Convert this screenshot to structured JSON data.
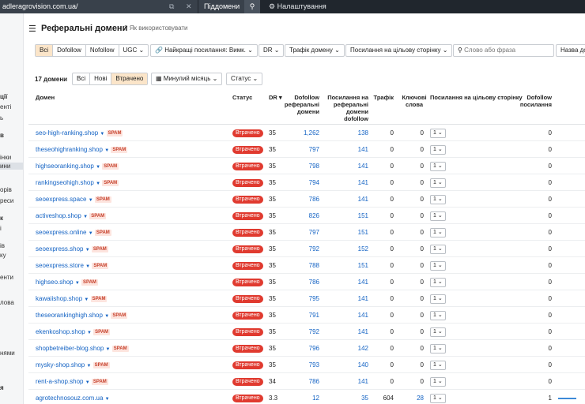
{
  "topbar": {
    "url": "adleragrovision.com.ua/",
    "subdomain_label": "Піддомени ⌄",
    "settings_label": "Налаштування"
  },
  "sidebar": {
    "fragments": [
      "ції",
      "енті",
      "ь",
      "в",
      "інки",
      "ини",
      "орів",
      "реси",
      "к",
      "і",
      "ів",
      "ку",
      "енти",
      "лова",
      "нями",
      "я"
    ]
  },
  "header": {
    "title": "Реферальні домени",
    "howto": "Як використовувати"
  },
  "filters": {
    "link_type": [
      "Всі",
      "Dofollow",
      "Nofollow",
      "UGC ⌄"
    ],
    "best_links": "Найкращі посилання: Вимк. ⌄",
    "dr": "DR ⌄",
    "domain_traffic": "Трафік домену ⌄",
    "target_links": "Посилання на цільову сторінку ⌄",
    "search_placeholder": "Слово або фраза",
    "domain_name": "Назва до"
  },
  "summary": {
    "count": "17 домени",
    "status_tabs": [
      "Всі",
      "Нові",
      "Втрачено"
    ],
    "period": "Минулий місяць ⌄",
    "status_filter": "Статус ⌄"
  },
  "columns": {
    "domain": "Домен",
    "status": "Статус",
    "dr": "DR ▾",
    "dofollow_ref": [
      "Dofollow",
      "реферальні",
      "домени"
    ],
    "links_ref": [
      "Посилання на",
      "реферальні",
      "домени",
      "dofollow"
    ],
    "traffic": "Трафік",
    "keywords": [
      "Ключові",
      "слова"
    ],
    "target_links": "Посилання на цільову сторінку",
    "dofollow_links": [
      "Dofollow",
      "посилання"
    ]
  },
  "rows": [
    {
      "domain": "seo-high-ranking.shop",
      "spam": "SPAM",
      "status": "Втрачено",
      "dr": "35",
      "dofollow": "1,262",
      "links": "138",
      "traffic": "0",
      "keywords": "0",
      "target": "1 ⌄",
      "dofollow_links": "0"
    },
    {
      "domain": "theseohighranking.shop",
      "spam": "SPAM",
      "status": "Втрачено",
      "dr": "35",
      "dofollow": "797",
      "links": "141",
      "traffic": "0",
      "keywords": "0",
      "target": "1 ⌄",
      "dofollow_links": "0"
    },
    {
      "domain": "highseoranking.shop",
      "spam": "SPAM",
      "status": "Втрачено",
      "dr": "35",
      "dofollow": "798",
      "links": "141",
      "traffic": "0",
      "keywords": "0",
      "target": "1 ⌄",
      "dofollow_links": "0"
    },
    {
      "domain": "rankingseohigh.shop",
      "spam": "SPAM",
      "status": "Втрачено",
      "dr": "35",
      "dofollow": "794",
      "links": "141",
      "traffic": "0",
      "keywords": "0",
      "target": "1 ⌄",
      "dofollow_links": "0"
    },
    {
      "domain": "seoexpress.space",
      "spam": "SPAM",
      "status": "Втрачено",
      "dr": "35",
      "dofollow": "786",
      "links": "141",
      "traffic": "0",
      "keywords": "0",
      "target": "1 ⌄",
      "dofollow_links": "0"
    },
    {
      "domain": "activeshop.shop",
      "spam": "SPAM",
      "status": "Втрачено",
      "dr": "35",
      "dofollow": "826",
      "links": "151",
      "traffic": "0",
      "keywords": "0",
      "target": "1 ⌄",
      "dofollow_links": "0"
    },
    {
      "domain": "seoexpress.online",
      "spam": "SPAM",
      "status": "Втрачено",
      "dr": "35",
      "dofollow": "797",
      "links": "151",
      "traffic": "0",
      "keywords": "0",
      "target": "1 ⌄",
      "dofollow_links": "0"
    },
    {
      "domain": "seoexpress.shop",
      "spam": "SPAM",
      "status": "Втрачено",
      "dr": "35",
      "dofollow": "792",
      "links": "152",
      "traffic": "0",
      "keywords": "0",
      "target": "1 ⌄",
      "dofollow_links": "0"
    },
    {
      "domain": "seoexpress.store",
      "spam": "SPAM",
      "status": "Втрачено",
      "dr": "35",
      "dofollow": "788",
      "links": "151",
      "traffic": "0",
      "keywords": "0",
      "target": "1 ⌄",
      "dofollow_links": "0"
    },
    {
      "domain": "highseo.shop",
      "spam": "SPAM",
      "status": "Втрачено",
      "dr": "35",
      "dofollow": "786",
      "links": "141",
      "traffic": "0",
      "keywords": "0",
      "target": "1 ⌄",
      "dofollow_links": "0"
    },
    {
      "domain": "kawaiishop.shop",
      "spam": "SPAM",
      "status": "Втрачено",
      "dr": "35",
      "dofollow": "795",
      "links": "141",
      "traffic": "0",
      "keywords": "0",
      "target": "1 ⌄",
      "dofollow_links": "0"
    },
    {
      "domain": "theseorankinghigh.shop",
      "spam": "SPAM",
      "status": "Втрачено",
      "dr": "35",
      "dofollow": "791",
      "links": "141",
      "traffic": "0",
      "keywords": "0",
      "target": "1 ⌄",
      "dofollow_links": "0"
    },
    {
      "domain": "ekenkoshop.shop",
      "spam": "SPAM",
      "status": "Втрачено",
      "dr": "35",
      "dofollow": "792",
      "links": "141",
      "traffic": "0",
      "keywords": "0",
      "target": "1 ⌄",
      "dofollow_links": "0"
    },
    {
      "domain": "shopbetreiber-blog.shop",
      "spam": "SPAM",
      "status": "Втрачено",
      "dr": "35",
      "dofollow": "796",
      "links": "142",
      "traffic": "0",
      "keywords": "0",
      "target": "1 ⌄",
      "dofollow_links": "0"
    },
    {
      "domain": "mysky-shop.shop",
      "spam": "SPAM",
      "status": "Втрачено",
      "dr": "35",
      "dofollow": "793",
      "links": "140",
      "traffic": "0",
      "keywords": "0",
      "target": "1 ⌄",
      "dofollow_links": "0"
    },
    {
      "domain": "rent-a-shop.shop",
      "spam": "SPAM",
      "status": "Втрачено",
      "dr": "34",
      "dofollow": "786",
      "links": "141",
      "traffic": "0",
      "keywords": "0",
      "target": "1 ⌄",
      "dofollow_links": "0"
    },
    {
      "domain": "agrotechnosouz.com.ua",
      "spam": "",
      "status": "Втрачено",
      "dr": "3.3",
      "dofollow": "12",
      "links": "35",
      "traffic": "604",
      "keywords": "28",
      "target": "1 ⌄",
      "dofollow_links": "1",
      "bar_fraction": 0.9
    }
  ],
  "colors": {
    "accent": "#fbe5c9",
    "lost": "#e03a2f",
    "link": "#1463c4",
    "spam_bg": "#fde4de"
  }
}
